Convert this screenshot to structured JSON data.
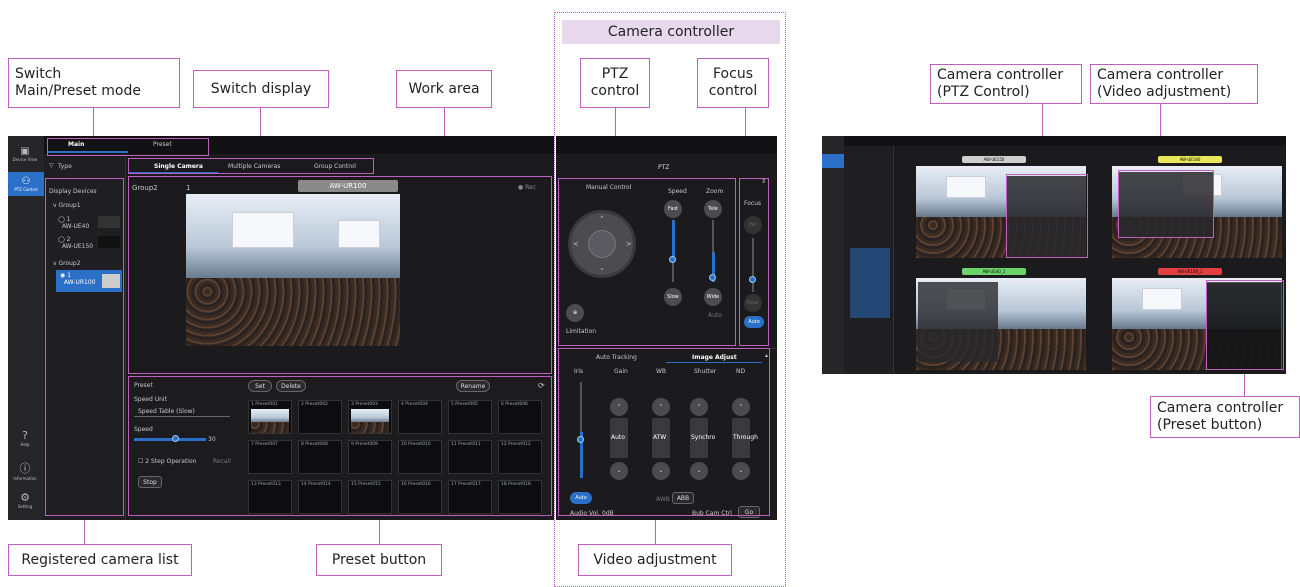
{
  "callouts": {
    "switch_mode": "Switch\nMain/Preset mode",
    "switch_display": "Switch display",
    "work_area": "Work area",
    "camera_controller": "Camera controller",
    "ptz_control": "PTZ\ncontrol",
    "focus_control": "Focus\ncontrol",
    "registered_list": "Registered camera list",
    "preset_button": "Preset button",
    "video_adjustment": "Video adjustment",
    "cc_ptz": "Camera controller\n(PTZ Control)",
    "cc_video": "Camera controller\n(Video adjustment)",
    "cc_preset": "Camera controller\n(Preset button)"
  },
  "app": {
    "top_tabs": [
      "Main",
      "Preset"
    ],
    "sidebar": {
      "items": [
        {
          "label": "Device View",
          "icon": "device-view-icon"
        },
        {
          "label": "PTZ Control",
          "icon": "camera-icon"
        },
        {
          "label": "Help",
          "icon": "help-icon"
        },
        {
          "label": "Information",
          "icon": "info-icon"
        },
        {
          "label": "Setting",
          "icon": "gear-icon"
        }
      ]
    },
    "filter_label": "Type",
    "display_devices_label": "Display Devices",
    "groups": [
      {
        "name": "Group1",
        "cameras": [
          {
            "num": "1",
            "model": "AW-UE40"
          },
          {
            "num": "2",
            "model": "AW-UE150"
          }
        ]
      },
      {
        "name": "Group2",
        "cameras": [
          {
            "num": "1",
            "model": "AW-UR100"
          }
        ]
      }
    ],
    "view_tabs": [
      "Single Camera",
      "Multiple Cameras",
      "Group Control"
    ],
    "work": {
      "group": "Group2",
      "cam_num": "1",
      "model": "AW-UR100",
      "rec": "● Rec"
    },
    "preset": {
      "title": "Preset",
      "set": "Set",
      "delete": "Delete",
      "rename": "Rename",
      "speed_unit_label": "Speed Unit",
      "speed_unit_value": "Speed Table (Slow)",
      "speed_label": "Speed",
      "speed_value": "30",
      "step_op": "2 Step Operation",
      "recall": "Recall",
      "stop": "Stop",
      "cells": [
        "Preset001",
        "Preset002",
        "Preset003",
        "Preset004",
        "Preset005",
        "Preset006",
        "Preset007",
        "Preset008",
        "Preset009",
        "Preset010",
        "Preset011",
        "Preset012",
        "Preset013",
        "Preset014",
        "Preset015",
        "Preset016",
        "Preset017",
        "Preset018"
      ]
    },
    "ptz": {
      "title": "PTZ",
      "manual_control": "Manual Control",
      "speed": "Speed",
      "zoom": "Zoom",
      "fast": "Fast",
      "tele": "Tele",
      "slow": "Slow",
      "wide": "Wide",
      "auto": "Auto",
      "limitation": "Limitation",
      "focus": "Focus",
      "far": "Far",
      "near": "Near"
    },
    "image": {
      "tabs": [
        "Auto Tracking",
        "Image Adjust"
      ],
      "cols": [
        "Iris",
        "Gain",
        "WB",
        "Shutter",
        "ND"
      ],
      "values": [
        "Auto",
        "ATW",
        "Synchro",
        "Through"
      ],
      "auto": "Auto",
      "awb": "AWB",
      "abb": "ABB",
      "audio_vol_label": "Audio Vol.",
      "audio_vol_value": "0dB",
      "bub_cam_ctrl": "Bub Cam Ctrl",
      "go": "Go"
    }
  },
  "mini": {
    "labels": [
      {
        "text": "AW-UE150",
        "color": "#cfcfcf"
      },
      {
        "text": "AW-UE160",
        "color": "#e8e85a"
      },
      {
        "text": "AW-UE40_1",
        "color": "#6ad46a"
      },
      {
        "text": "AW-UE100_1",
        "color": "#e24040"
      }
    ]
  },
  "colors": {
    "accent": "#2a6fc8",
    "callout_border": "#c05fc0",
    "app_bg": "#1b1b1d"
  }
}
